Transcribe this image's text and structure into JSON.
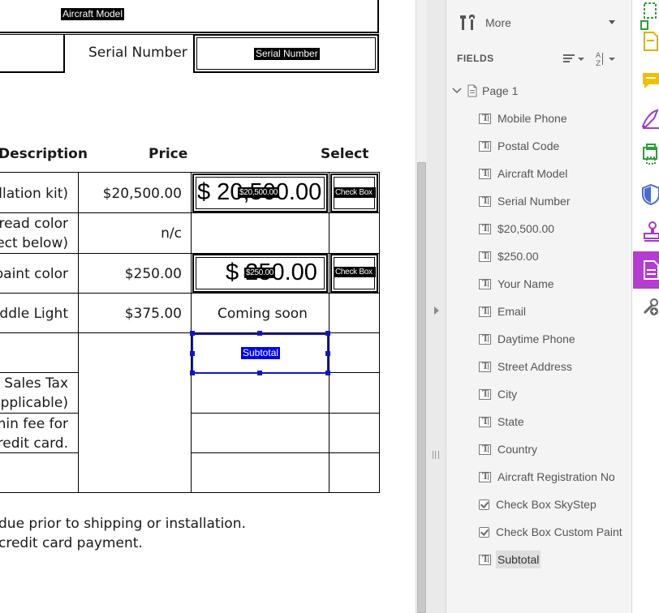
{
  "form": {
    "aircraft_model_tag": "Aircraft Model",
    "serial_number_label": "Serial Number",
    "serial_number_tag": "Serial Number",
    "table_headers": {
      "description": "Description",
      "price": "Price",
      "select": "Select"
    },
    "rows": [
      {
        "desc": "allation kit)",
        "price": "$20,500.00",
        "field_value": "$ 20,500.00",
        "field_tag": "$20,500.00",
        "select_tag": "Check Box"
      },
      {
        "desc1": "tread color",
        "desc2": "ect below)",
        "price": "n/c"
      },
      {
        "desc": "paint color",
        "price": "$250.00",
        "field_value": "$ 250.00",
        "field_tag": "$250.00",
        "select_tag": "Check Box"
      },
      {
        "desc": "uddle Light",
        "price": "$375.00",
        "note": "Coming soon"
      },
      {
        "subtotal_tag": "Subtotal"
      },
      {
        "desc1": "X Sales Tax",
        "desc2": "applicable)"
      },
      {
        "desc1": "min fee for",
        "desc2": "redit card."
      }
    ],
    "footnote1": "due prior to shipping or installation.",
    "footnote2": "credit card payment."
  },
  "panel": {
    "more_label": "More",
    "fields_heading": "FIELDS",
    "page_label": "Page 1",
    "fields": [
      {
        "label": "Mobile Phone",
        "type": "text"
      },
      {
        "label": "Postal Code",
        "type": "text"
      },
      {
        "label": "Aircraft Model",
        "type": "text"
      },
      {
        "label": "Serial Number",
        "type": "text"
      },
      {
        "label": "$20,500.00",
        "type": "text"
      },
      {
        "label": "$250.00",
        "type": "text"
      },
      {
        "label": "Your Name",
        "type": "text"
      },
      {
        "label": "Email",
        "type": "text"
      },
      {
        "label": "Daytime Phone",
        "type": "text"
      },
      {
        "label": "Street Address",
        "type": "text"
      },
      {
        "label": "City",
        "type": "text"
      },
      {
        "label": "State",
        "type": "text"
      },
      {
        "label": "Country",
        "type": "text"
      },
      {
        "label": "Aircraft Registration No",
        "type": "text"
      },
      {
        "label": "Check Box SkyStep",
        "type": "checkbox"
      },
      {
        "label": "Check Box Custom Paint",
        "type": "checkbox"
      },
      {
        "label": "Subtotal",
        "type": "text",
        "selected": true
      }
    ]
  },
  "rail": {
    "tools": [
      "export-pdf-icon",
      "create-pdf-icon",
      "comment-icon",
      "fill-sign-icon",
      "print-production-icon",
      "protect-icon",
      "stamp-icon",
      "prepare-form-icon",
      "more-tools-icon"
    ],
    "active_tool": "prepare-form-icon",
    "accent": "#b53bd1"
  }
}
